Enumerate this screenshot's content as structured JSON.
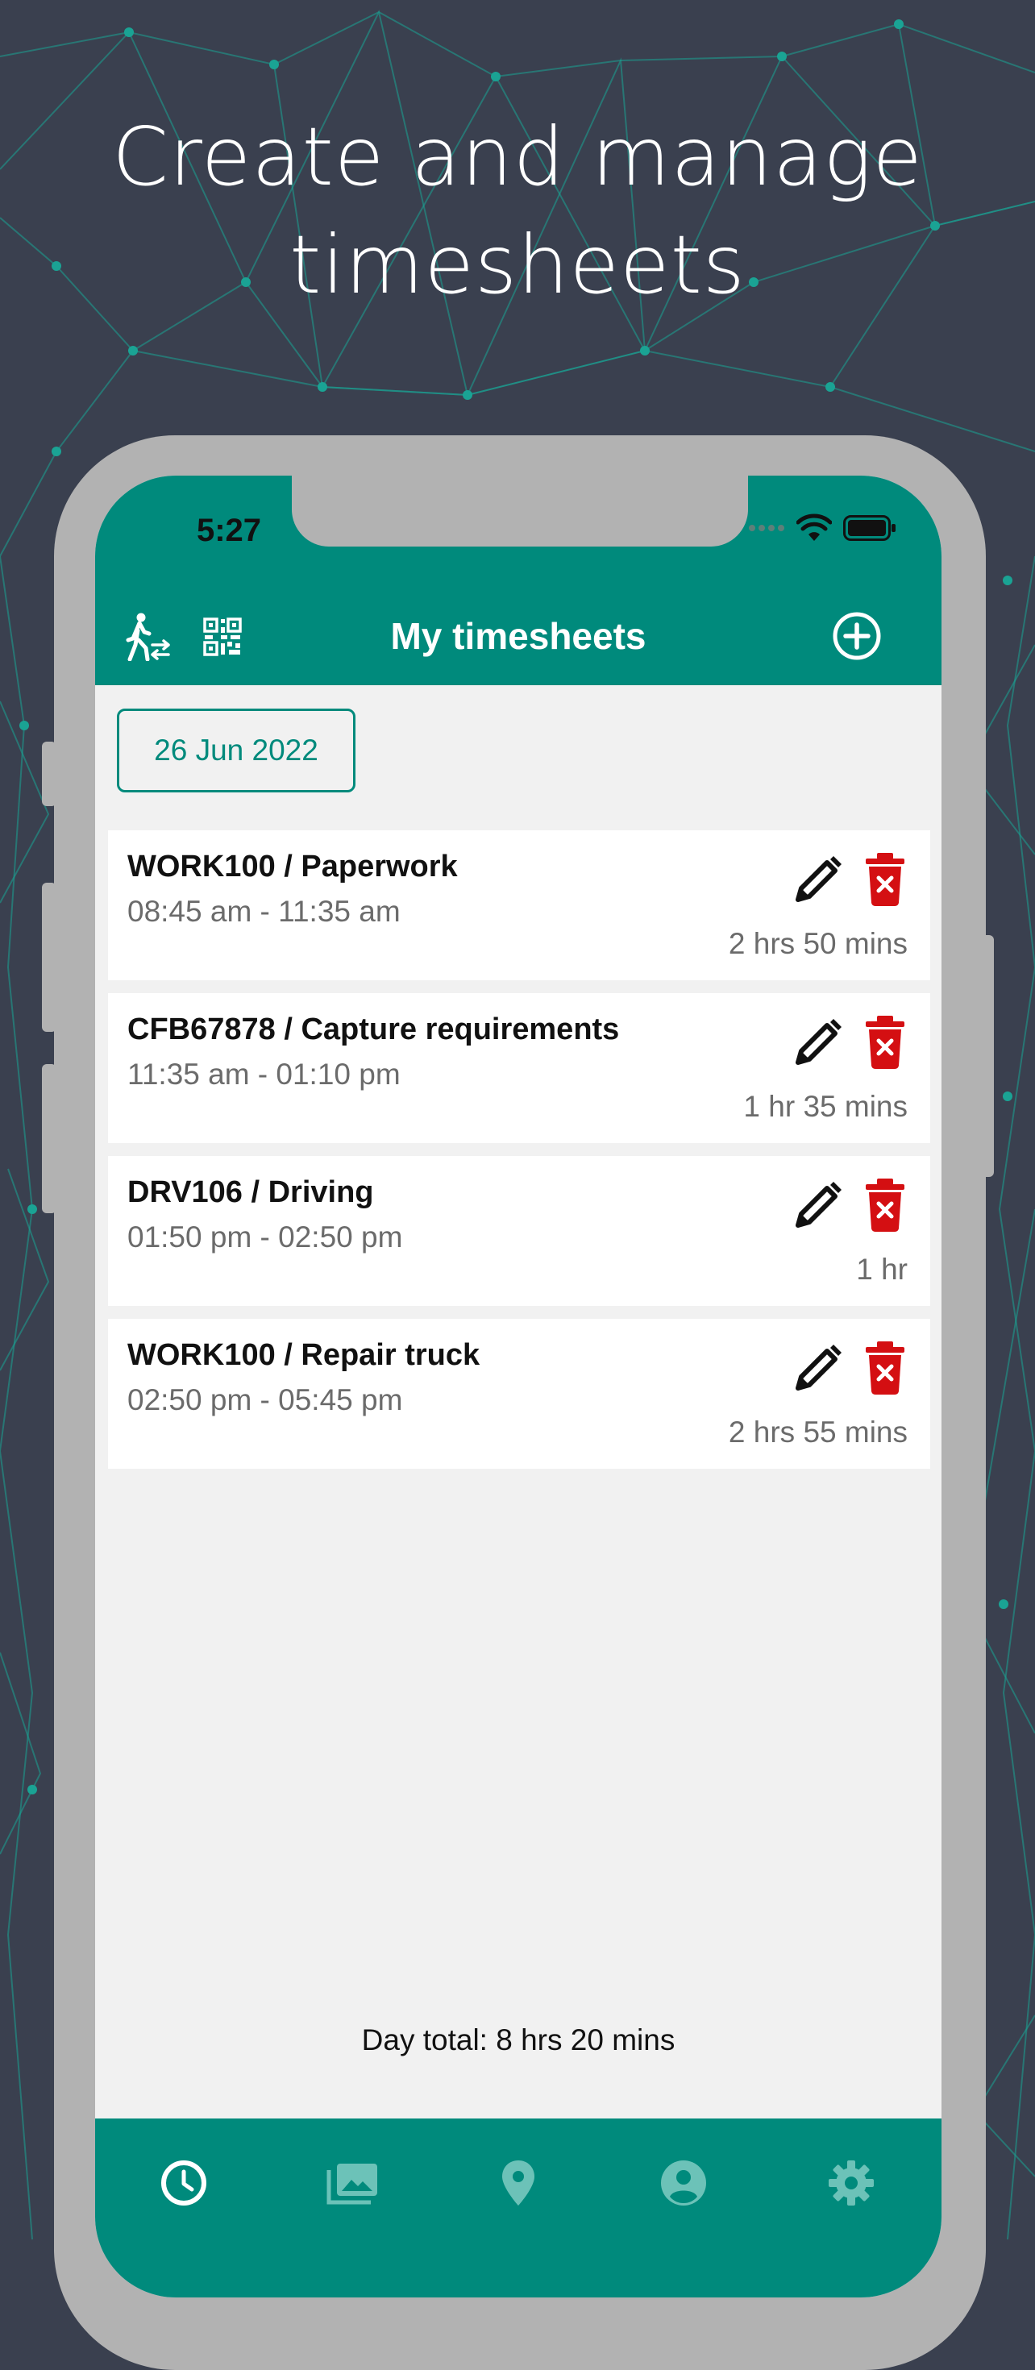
{
  "promo": {
    "headline_line1": "Create and manage",
    "headline_line2": "timesheets"
  },
  "status_bar": {
    "time": "5:27"
  },
  "app_bar": {
    "title": "My timesheets",
    "left_icons": [
      "person-walking-arrows-icon",
      "qr-code-icon"
    ],
    "right_icon": "add-circle-icon"
  },
  "date_filter": {
    "label": "26 Jun 2022"
  },
  "entries": [
    {
      "title": "WORK100 / Paperwork",
      "time_range": "08:45 am - 11:35 am",
      "duration": "2 hrs 50 mins"
    },
    {
      "title": "CFB67878 / Capture requirements",
      "time_range": "11:35 am - 01:10 pm",
      "duration": "1 hr 35 mins"
    },
    {
      "title": "DRV106 / Driving",
      "time_range": "01:50 pm - 02:50 pm",
      "duration": "1 hr"
    },
    {
      "title": "WORK100 / Repair truck",
      "time_range": "02:50 pm - 05:45 pm",
      "duration": "2 hrs 55 mins"
    }
  ],
  "day_total": "Day total: 8 hrs 20 mins",
  "bottom_nav": {
    "items": [
      "clock-icon",
      "photos-icon",
      "location-pin-icon",
      "account-icon",
      "settings-gear-icon"
    ],
    "active": "clock-icon"
  },
  "colors": {
    "background": "#3a404f",
    "network_lines": "#1aa394",
    "accent": "#008a7c",
    "delete": "#d40f12",
    "phone_frame": "#b2b2b2",
    "screen_bg": "#f1f1f1"
  }
}
